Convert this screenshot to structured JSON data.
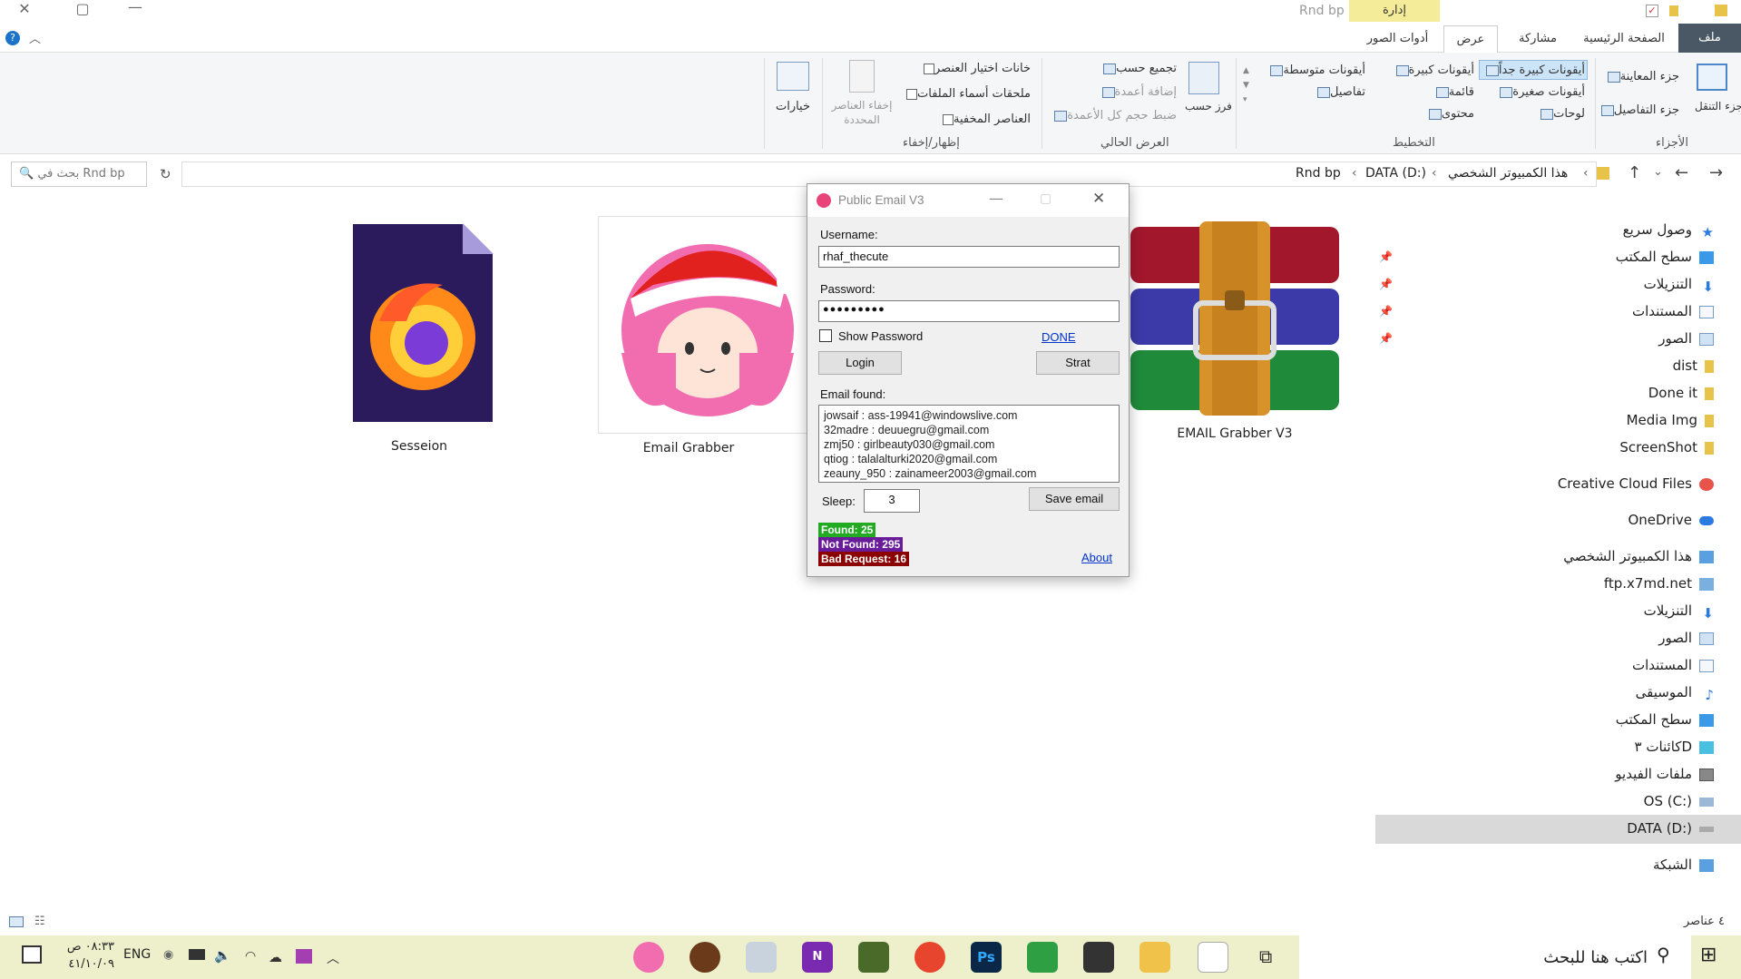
{
  "window": {
    "title": "Rnd bp",
    "context_tab": "إدارة",
    "tabs": [
      "ملف",
      "الصفحة الرئيسية",
      "مشاركة",
      "عرض",
      "أدوات الصور"
    ]
  },
  "ribbon": {
    "panes": {
      "label": "الأجزاء",
      "nav_pane": "جزء التنقل",
      "preview_pane": "جزء المعاينة",
      "details_pane": "جزء التفاصيل"
    },
    "layout": {
      "label": "التخطيط",
      "items": [
        "أيقونات كبيرة جداً",
        "أيقونات كبيرة",
        "أيقونات متوسطة",
        "أيقونات صغيرة",
        "قائمة",
        "تفاصيل",
        "لوحات",
        "محتوى"
      ]
    },
    "current_view": {
      "label": "العرض الحالي",
      "sort": "فرز حسب",
      "group": "تجميع حسب",
      "add_columns": "إضافة أعمدة",
      "fit_columns": "ضبط حجم كل الأعمدة"
    },
    "show_hide": {
      "label": "إظهار/إخفاء",
      "item_checkboxes": "خانات اختيار العنصر",
      "file_extensions": "ملحقات أسماء الملفات",
      "hidden_items": "العناصر المخفية",
      "hide_selected": "إخفاء العناصر المحددة"
    },
    "options": "خيارات"
  },
  "address": {
    "crumbs": [
      "هذا الكمبيوتر الشخصي",
      "DATA (D:)",
      "Rnd bp"
    ],
    "search_placeholder": "بحث في Rnd bp"
  },
  "nav": {
    "quick_access": "وصول سريع",
    "items": [
      "سطح المكتب",
      "التنزيلات",
      "المستندات",
      "الصور",
      "dist",
      "Done it",
      "Media Img",
      "ScreenShot"
    ],
    "creative_cloud": "Creative Cloud Files",
    "onedrive": "OneDrive",
    "this_pc": "هذا الكمبيوتر الشخصي",
    "pc_items": [
      "ftp.x7md.net",
      "التنزيلات",
      "الصور",
      "المستندات",
      "الموسيقى",
      "سطح المكتب",
      "كائنات ٣D",
      "ملفات الفيديو",
      "OS (C:)",
      "DATA (D:)"
    ],
    "network": "الشبكة"
  },
  "files": [
    {
      "name": "Sesseion",
      "icon": "firefox-icon"
    },
    {
      "name": "Email Grabber",
      "icon": "anime-girl-icon"
    },
    {
      "name": "EMAIL Grabber V3",
      "icon": "winrar-icon"
    }
  ],
  "status": {
    "count": "٤ عناصر"
  },
  "dialog": {
    "title": "Public Email V3",
    "username_label": "Username:",
    "username_value": "rhaf_thecute",
    "password_label": "Password:",
    "password_value": "●●●●●●●●●",
    "show_password": "Show Password",
    "done_link": "DONE",
    "login_button": "Login",
    "start_button": "Strat",
    "email_found_label": "Email found:",
    "emails": [
      "jowsaif : ass-19941@windowslive.com",
      "32madre : deuuegru@gmail.com",
      "zmj50 : girlbeauty030@gmail.com",
      "qtiog : talalalturki2020@gmail.com",
      "zeauny_950 : zainameer2003@gmail.com"
    ],
    "sleep_label": "Sleep:",
    "sleep_value": "3",
    "save_button": "Save email",
    "found": "Found: 25",
    "not_found": "Not Found: 295",
    "bad_request": "Bad Request: 16",
    "about_link": "About",
    "colors": {
      "found": "#22aa22",
      "not_found": "#6a1b9a",
      "bad_request": "#8b0000"
    }
  },
  "taskbar": {
    "search": "اكتب هنا للبحث",
    "time": "٠٨:٣٣ ص",
    "date": "٤١/١٠/٠٩",
    "lang": "ENG"
  }
}
